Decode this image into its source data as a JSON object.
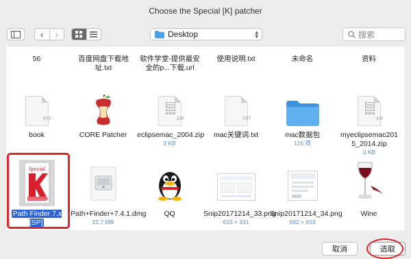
{
  "window": {
    "title": "Choose the Special [K] patcher"
  },
  "toolbar": {
    "location": "Desktop",
    "search_placeholder": "搜索"
  },
  "row0": [
    {
      "label": "56"
    },
    {
      "label": "百度网盘下载地址.txt"
    },
    {
      "label": "软件学堂-提供最安全的p...下载.url"
    },
    {
      "label": "使用说明.txt"
    },
    {
      "label": "未命名"
    },
    {
      "label": "资料"
    }
  ],
  "row1": [
    {
      "label": "book",
      "badge": "RTF"
    },
    {
      "label": "CORE Patcher"
    },
    {
      "label": "eclipsemac_2004.zip",
      "sub": "3 KB",
      "badge": "ZIP"
    },
    {
      "label": "mac关键词.txt",
      "badge": "TXT"
    },
    {
      "label": "mac数据包",
      "sub": "116 项"
    },
    {
      "label": "myeclipsemac2015_2014.zip",
      "sub": "3 KB",
      "badge": "ZIP"
    }
  ],
  "row2": [
    {
      "label": "Path Finder 7.x [SP]",
      "box_text": "Special"
    },
    {
      "label": "Path+Finder+7.4.1.dmg",
      "sub": "22.7 MB"
    },
    {
      "label": "QQ"
    },
    {
      "label": "Snip20171214_33.png",
      "sub": "633 × 431"
    },
    {
      "label": "Snip20171214_34.png",
      "sub": "692 × 653"
    },
    {
      "label": "Wine"
    }
  ],
  "buttons": {
    "cancel": "取消",
    "choose": "选取"
  },
  "colors": {
    "selection": "#2b63d9",
    "highlight_red": "#e0262a",
    "folder_blue": "#4aa3e8"
  }
}
